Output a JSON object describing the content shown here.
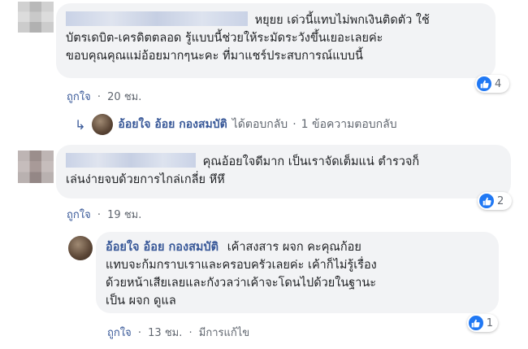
{
  "comment1": {
    "text_line1": "หยุยย เด่วนี้แทบไม่พกเงินติดตัว ใช้",
    "text_line2": "บัตรเดบิต-เครดิตตลอด รู้แบบนี้ช่วยให้ระมัดระวังขึ้นเยอะเลยค่ะ",
    "text_line3": "ขอบคุณคุณแม่อ้อยมากๆนะคะ ที่มาแชร์ประสบการณ์แบบนี้",
    "like_label": "ถูกใจ",
    "sep": "·",
    "time": "20 ชม.",
    "reaction_count": "4"
  },
  "reply_summary": {
    "name": "อ้อยใจ อ้อย กองสมบัติ",
    "action": "ได้ตอบกลับ",
    "sep": "·",
    "count_text": "1 ข้อความตอบกลับ"
  },
  "comment2": {
    "text_line1": "คุณอ้อยใจดีมาก เป็นเราจัดเต็มแน่ ตำรวจก็",
    "text_line2": "เล่นง่ายจบด้วยการไกล่เกลี่ย หึหึ",
    "like_label": "ถูกใจ",
    "sep": "·",
    "time": "19 ชม.",
    "reaction_count": "2"
  },
  "reply": {
    "name": "อ้อยใจ อ้อย กองสมบัติ",
    "text_line1": "เค้าสงสาร ผจก คะคุณก้อย",
    "text_line2": "แทบจะก้มกราบเราและครอบครัวเลยค่ะ เค้าก็ไม่รู้เรื่อง",
    "text_line3": "ด้วยหน้าเสียเลยและกังวลว่าเค้าจะโดนไปด้วยในฐานะ",
    "text_line4": "เป็น ผจก ดูแล",
    "like_label": "ถูกใจ",
    "sep": "·",
    "time": "13 ชม.",
    "sep2": "·",
    "edited": "มีการแก้ไข",
    "reaction_count": "1"
  },
  "colors": {
    "link": "#385898",
    "bubble": "#f2f3f5",
    "like": "#2078f4"
  }
}
